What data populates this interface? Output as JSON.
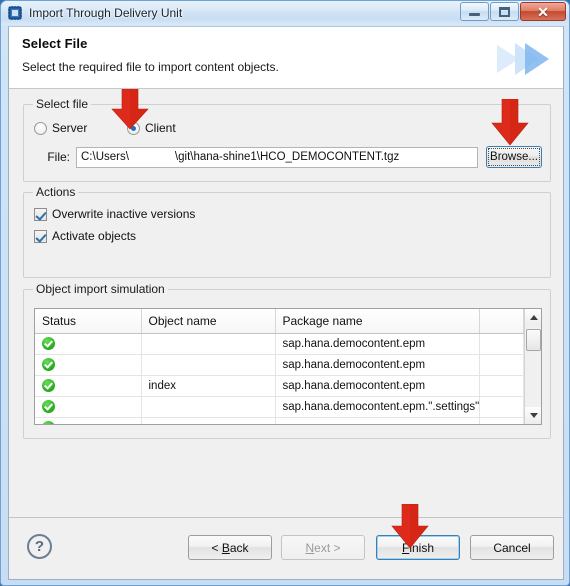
{
  "window": {
    "title": "Import Through Delivery Unit",
    "icon": "delivery-unit-icon",
    "minimize_label": "",
    "maximize_label": "",
    "close_label": "✕"
  },
  "banner": {
    "title": "Select File",
    "subtitle": "Select the required file to import content objects.",
    "art": "blue-arrows-decoration"
  },
  "select_file": {
    "group_label": "Select file",
    "options": [
      {
        "label": "Server",
        "selected": false
      },
      {
        "label": "Client",
        "selected": true
      }
    ],
    "file_label": "File:",
    "file_value_prefix": "C:\\Users\\",
    "file_value_suffix": "\\git\\hana-shine1\\HCO_DEMOCONTENT.tgz",
    "file_value_redacted": true,
    "browse_label": "Browse..."
  },
  "actions": {
    "group_label": "Actions",
    "items": [
      {
        "label": "Overwrite inactive versions",
        "checked": true
      },
      {
        "label": "Activate objects",
        "checked": true
      }
    ]
  },
  "simulation": {
    "group_label": "Object import simulation",
    "columns": [
      "Status",
      "Object name",
      "Package name",
      ""
    ],
    "rows": [
      {
        "status": "ok",
        "object": "",
        "package": "sap.hana.democontent.epm"
      },
      {
        "status": "ok",
        "object": "",
        "package": "sap.hana.democontent.epm"
      },
      {
        "status": "ok",
        "object": "index",
        "package": "sap.hana.democontent.epm"
      },
      {
        "status": "ok",
        "object": "",
        "package": "sap.hana.democontent.epm.\".settings\""
      },
      {
        "status": "ok",
        "object": "",
        "package": ""
      }
    ],
    "scrollbar": {
      "up_arrow": "scroll-up-icon",
      "down_arrow": "scroll-down-icon"
    }
  },
  "buttonbar": {
    "help": "?",
    "buttons": [
      {
        "id": "back",
        "label": "< Back",
        "mnemonic": "B",
        "disabled": false,
        "focused": false
      },
      {
        "id": "next",
        "label": "Next >",
        "mnemonic": "N",
        "disabled": true,
        "focused": false
      },
      {
        "id": "finish",
        "label": "Finish",
        "mnemonic": "F",
        "disabled": false,
        "focused": true
      },
      {
        "id": "cancel",
        "label": "Cancel",
        "mnemonic": "",
        "disabled": false,
        "focused": false
      }
    ]
  },
  "annotations": {
    "color": "#dd2a1b",
    "arrows": [
      {
        "target": "client-radio"
      },
      {
        "target": "browse-button"
      },
      {
        "target": "finish-button"
      }
    ]
  }
}
